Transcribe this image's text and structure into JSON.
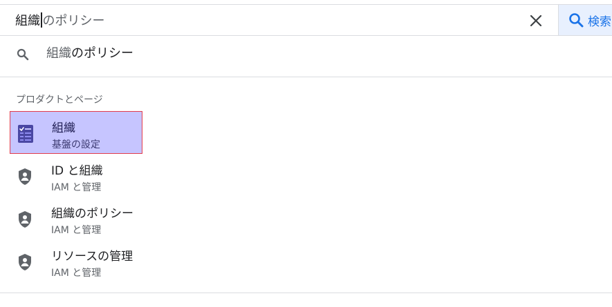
{
  "search": {
    "typed": "組織",
    "suggest": "のポリシー",
    "button_label": "検索"
  },
  "query_suggestion": {
    "match": "組織",
    "rest": "のポリシー"
  },
  "section_header": "プロダクトとページ",
  "results": [
    {
      "title": "組織",
      "subtitle": "基盤の設定",
      "icon": "checklist-icon"
    },
    {
      "title": "ID と組織",
      "subtitle": "IAM と管理",
      "icon": "shield-person-icon"
    },
    {
      "title": "組織のポリシー",
      "subtitle": "IAM と管理",
      "icon": "shield-person-icon"
    },
    {
      "title": "リソースの管理",
      "subtitle": "IAM と管理",
      "icon": "shield-person-icon"
    }
  ],
  "colors": {
    "accent": "#1a73e8",
    "highlight": "#c6c5ff",
    "highlight_border": "#e23b4c",
    "icon_gray": "#5f6368"
  }
}
